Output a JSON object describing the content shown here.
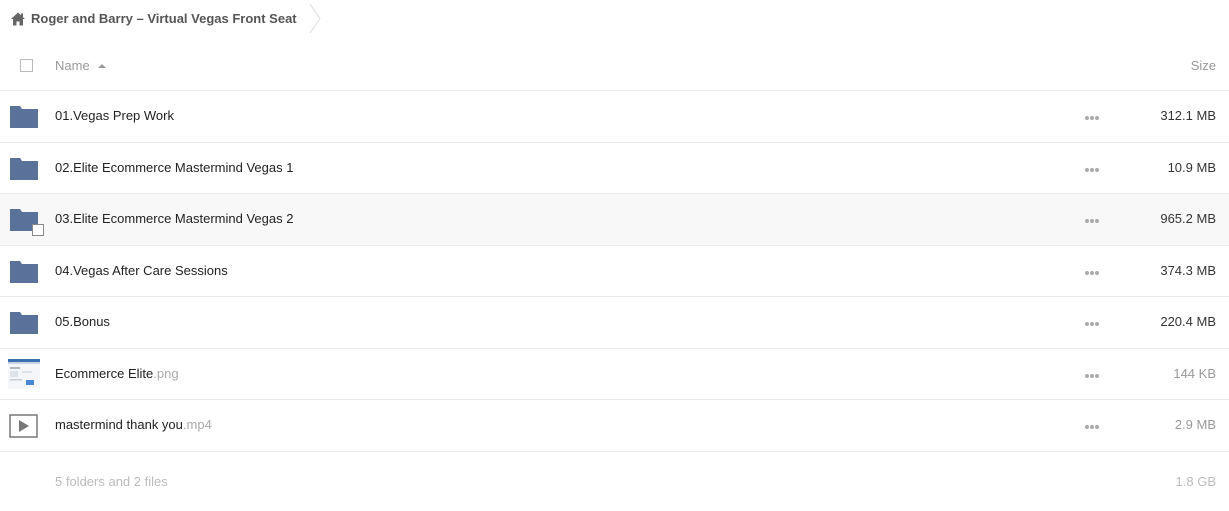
{
  "breadcrumb": {
    "title": "Roger and Barry – Virtual Vegas Front Seat"
  },
  "header": {
    "name_label": "Name",
    "size_label": "Size"
  },
  "rows": [
    {
      "kind": "folder",
      "name": "01.Vegas Prep Work",
      "ext": "",
      "size": "312.1 MB",
      "icon": "folder-icon"
    },
    {
      "kind": "folder",
      "name": "02.Elite Ecommerce Mastermind Vegas 1",
      "ext": "",
      "size": "10.9 MB",
      "icon": "folder-icon"
    },
    {
      "kind": "folder",
      "name": "03.Elite Ecommerce Mastermind Vegas 2",
      "ext": "",
      "size": "965.2 MB",
      "icon": "folder-icon"
    },
    {
      "kind": "folder",
      "name": "04.Vegas After Care Sessions",
      "ext": "",
      "size": "374.3 MB",
      "icon": "folder-icon"
    },
    {
      "kind": "folder",
      "name": "05.Bonus",
      "ext": "",
      "size": "220.4 MB",
      "icon": "folder-icon"
    },
    {
      "kind": "image",
      "name": "Ecommerce Elite",
      "ext": ".png",
      "size": "144 KB",
      "icon": "image-thumbnail"
    },
    {
      "kind": "video",
      "name": "mastermind thank you",
      "ext": ".mp4",
      "size": "2.9 MB",
      "icon": "video-play-icon"
    }
  ],
  "footer": {
    "summary": "5 folders and 2 files",
    "total": "1.8 GB"
  },
  "colors": {
    "folder": "#5a7199",
    "text": "#222222",
    "muted": "#999999",
    "divider": "#eaeaea"
  }
}
